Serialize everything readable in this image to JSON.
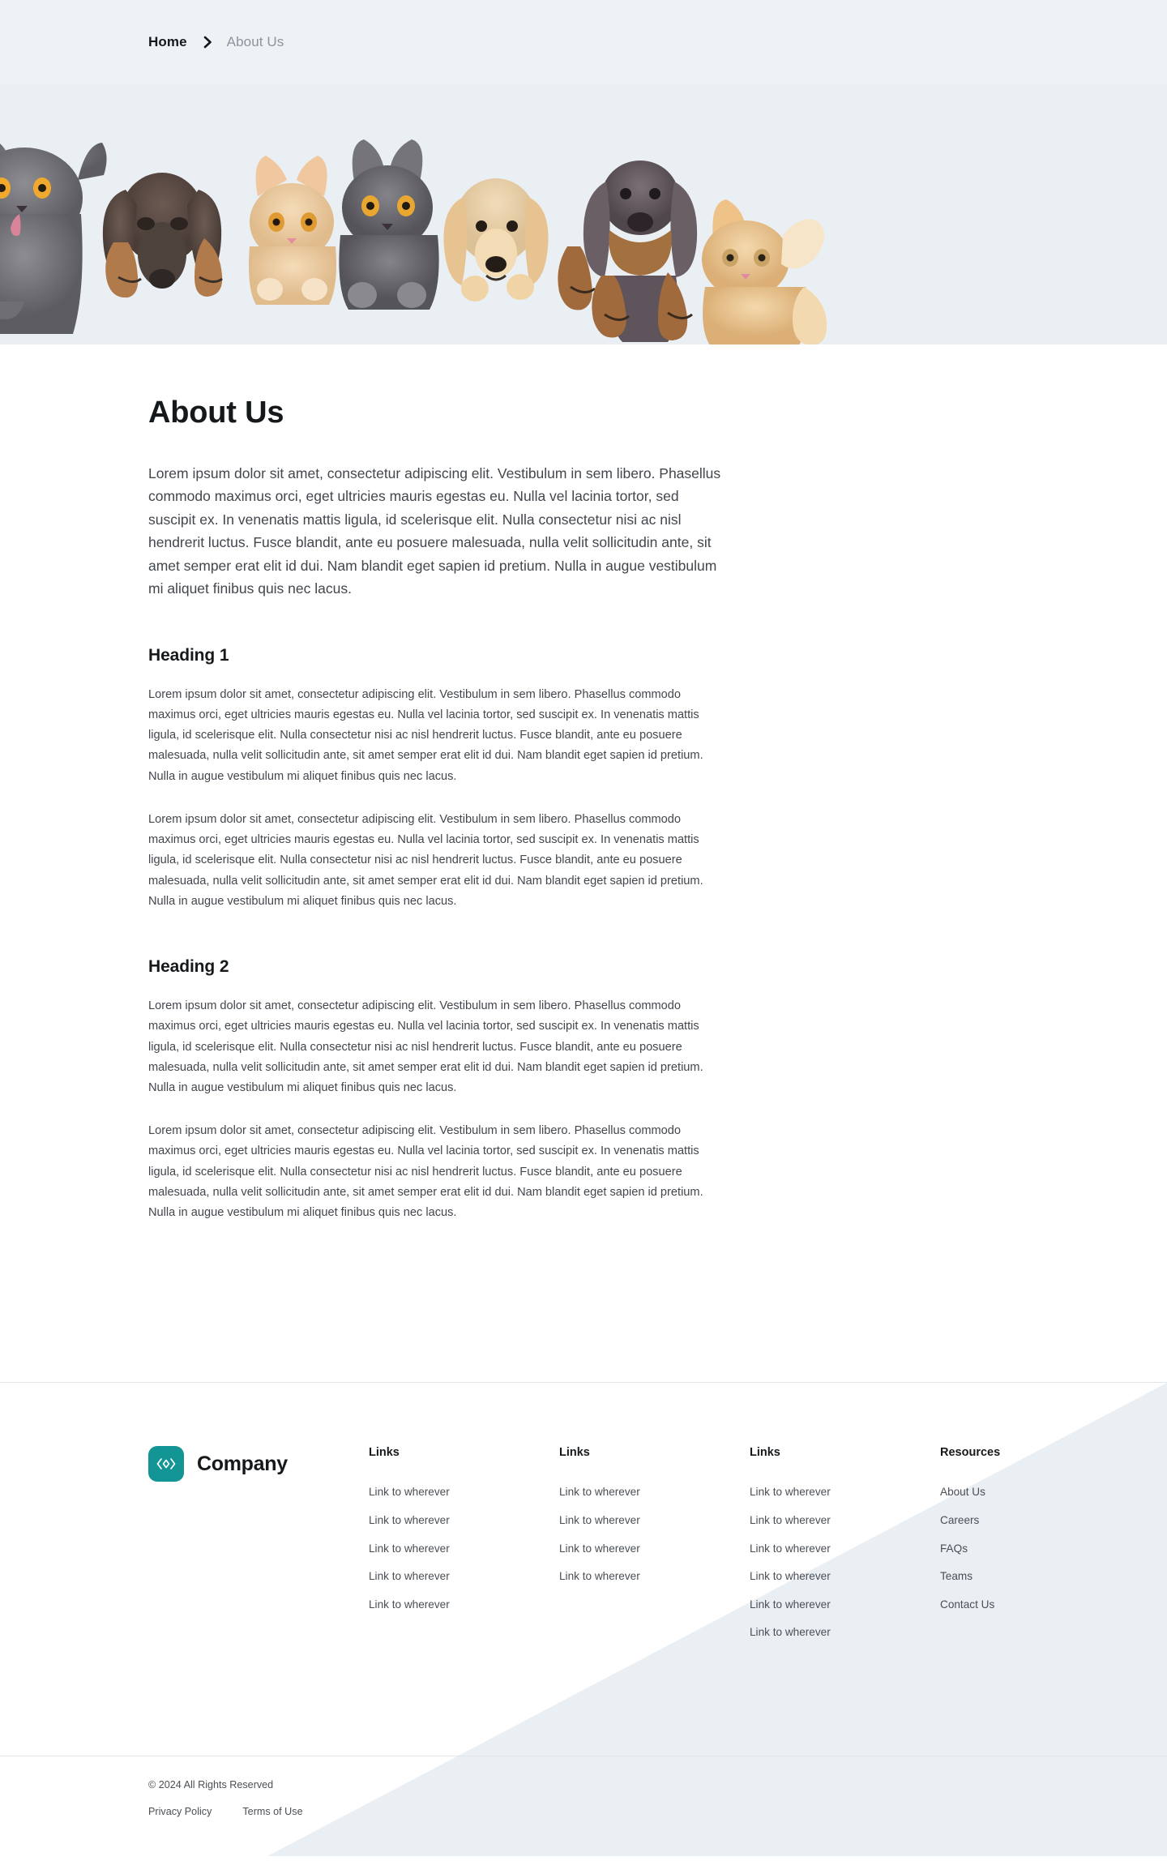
{
  "breadcrumb": {
    "home_label": "Home",
    "separator_icon": "chevron-right-icon",
    "current_label": "About Us"
  },
  "hero": {
    "alt": "row of kittens and puppies peeking over a banner",
    "background_color": "#eaeff3"
  },
  "main": {
    "title": "About Us",
    "intro": "Lorem ipsum dolor sit amet, consectetur adipiscing elit. Vestibulum in sem libero. Phasellus commodo maximus orci, eget ultricies mauris egestas eu. Nulla vel lacinia tortor, sed suscipit ex. In venenatis mattis ligula, id scelerisque elit. Nulla consectetur nisi ac nisl hendrerit luctus. Fusce blandit, ante eu posuere malesuada, nulla velit sollicitudin ante, sit amet semper erat elit id dui. Nam blandit eget sapien id pretium. Nulla in augue vestibulum mi aliquet finibus quis nec lacus.",
    "sections": [
      {
        "heading": "Heading 1",
        "paragraphs": [
          "Lorem ipsum dolor sit amet, consectetur adipiscing elit. Vestibulum in sem libero. Phasellus commodo maximus orci, eget ultricies mauris egestas eu. Nulla vel lacinia tortor, sed suscipit ex. In venenatis mattis ligula, id scelerisque elit. Nulla consectetur nisi ac nisl hendrerit luctus. Fusce blandit, ante eu posuere malesuada, nulla velit sollicitudin ante, sit amet semper erat elit id dui. Nam blandit eget sapien id pretium. Nulla in augue vestibulum mi aliquet finibus quis nec lacus.",
          "Lorem ipsum dolor sit amet, consectetur adipiscing elit. Vestibulum in sem libero. Phasellus commodo maximus orci, eget ultricies mauris egestas eu. Nulla vel lacinia tortor, sed suscipit ex. In venenatis mattis ligula, id scelerisque elit. Nulla consectetur nisi ac nisl hendrerit luctus. Fusce blandit, ante eu posuere malesuada, nulla velit sollicitudin ante, sit amet semper erat elit id dui. Nam blandit eget sapien id pretium. Nulla in augue vestibulum mi aliquet finibus quis nec lacus."
        ]
      },
      {
        "heading": "Heading 2",
        "paragraphs": [
          "Lorem ipsum dolor sit amet, consectetur adipiscing elit. Vestibulum in sem libero. Phasellus commodo maximus orci, eget ultricies mauris egestas eu. Nulla vel lacinia tortor, sed suscipit ex. In venenatis mattis ligula, id scelerisque elit. Nulla consectetur nisi ac nisl hendrerit luctus. Fusce blandit, ante eu posuere malesuada, nulla velit sollicitudin ante, sit amet semper erat elit id dui. Nam blandit eget sapien id pretium. Nulla in augue vestibulum mi aliquet finibus quis nec lacus.",
          "Lorem ipsum dolor sit amet, consectetur adipiscing elit. Vestibulum in sem libero. Phasellus commodo maximus orci, eget ultricies mauris egestas eu. Nulla vel lacinia tortor, sed suscipit ex. In venenatis mattis ligula, id scelerisque elit. Nulla consectetur nisi ac nisl hendrerit luctus. Fusce blandit, ante eu posuere malesuada, nulla velit sollicitudin ante, sit amet semper erat elit id dui. Nam blandit eget sapien id pretium. Nulla in augue vestibulum mi aliquet finibus quis nec lacus."
        ]
      }
    ]
  },
  "footer": {
    "brand_name": "Company",
    "logo_icon": "code-diamond-icon",
    "logo_color": "#139595",
    "diagonal_color": "#eaeff3",
    "columns": [
      {
        "title": "Links",
        "links": [
          "Link to wherever",
          "Link to wherever",
          "Link to wherever",
          "Link to wherever",
          "Link to wherever"
        ]
      },
      {
        "title": "Links",
        "links": [
          "Link to wherever",
          "Link to wherever",
          "Link to wherever",
          "Link to wherever"
        ]
      },
      {
        "title": "Links",
        "links": [
          "Link to wherever",
          "Link to wherever",
          "Link to wherever",
          "Link to wherever",
          "Link to wherever",
          "Link to wherever"
        ]
      },
      {
        "title": "Resources",
        "links": [
          "About Us",
          "Careers",
          "FAQs",
          "Teams",
          "Contact Us"
        ]
      }
    ],
    "copyright": "© 2024 All Rights Reserved",
    "legal": [
      "Privacy Policy",
      "Terms of Use"
    ]
  }
}
